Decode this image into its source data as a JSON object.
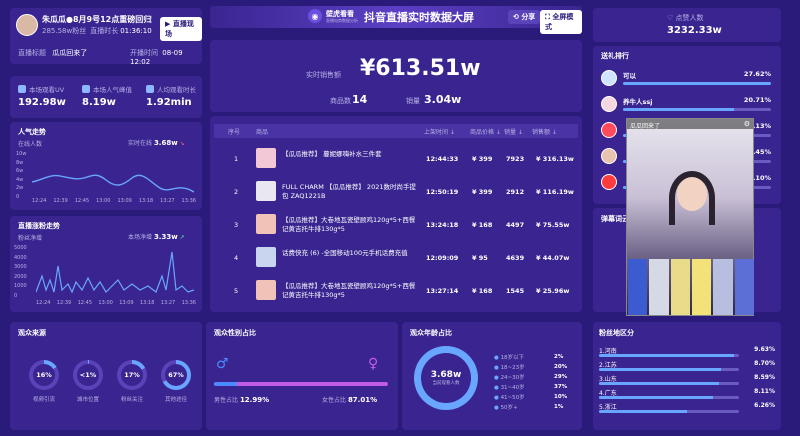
{
  "header": {
    "streamer_name": "朱瓜瓜●8月9号12点重磅回归宋...",
    "fans": "285.58w粉丝",
    "live_duration_label": "直播时长",
    "live_duration": "01:36:10",
    "live_button": "直播现场",
    "live_title_label": "直播标题",
    "live_title": "瓜瓜回来了",
    "start_label": "开播时间",
    "start_time": "08-09 12:02",
    "brand_name": "壁虎看看",
    "brand_sub": "直播电商数据分析",
    "screen_title": "抖音直播实时数据大屏",
    "share_button": "分享",
    "fullscreen_button": "全屏模式",
    "likes_label": "点赞人数",
    "likes_value": "3232.33w"
  },
  "metrics": [
    {
      "label": "本场观看UV",
      "value": "192.98w",
      "icon": "eye-icon"
    },
    {
      "label": "本场人气峰值",
      "value": "8.19w",
      "icon": "fire-icon"
    },
    {
      "label": "人均观看时长",
      "value": "1.92min",
      "icon": "clock-icon"
    }
  ],
  "popularity": {
    "title": "人气走势",
    "sub_label": "在线人数",
    "rt_label": "实时在线",
    "rt_value": "3.68w",
    "y_ticks": [
      "10w",
      "8w",
      "6w",
      "4w",
      "2w",
      "0"
    ],
    "x_ticks": [
      "12:24",
      "12:39",
      "12:45",
      "13:00",
      "13:09",
      "13:18",
      "13:27",
      "13:36"
    ]
  },
  "fans_trend": {
    "title": "直播涨粉走势",
    "sub_label": "粉丝净增",
    "rt_label": "本场净增",
    "rt_value": "3.33w",
    "y_ticks": [
      "5000",
      "4000",
      "3000",
      "2000",
      "1000",
      "0"
    ],
    "x_ticks": [
      "12:24",
      "12:39",
      "12:45",
      "13:00",
      "13:09",
      "13:18",
      "13:27",
      "13:36"
    ]
  },
  "sales": {
    "label": "实时销售额",
    "value": "¥613.51w",
    "count_label": "商品数",
    "count": "14",
    "volume_label": "销量",
    "volume": "3.04w"
  },
  "products": {
    "headers": [
      "序号",
      "商品",
      "上架时间 ↓",
      "商品价格 ↓",
      "销量 ↓",
      "销售额 ↓"
    ],
    "rows": [
      {
        "idx": "1",
        "name": "【瓜瓜推荐】 蔓妮娜嗨补水三件套",
        "time": "12:44:33",
        "price": "¥ 399",
        "sold": "7923",
        "revenue": "¥ 316.13w"
      },
      {
        "idx": "2",
        "name": "FULL CHARM 【瓜瓜推荐】 2021数时尚手提包 ZAQ1221B",
        "time": "12:50:19",
        "price": "¥ 399",
        "sold": "2912",
        "revenue": "¥ 116.19w"
      },
      {
        "idx": "3",
        "name": "【瓜瓜推荐】大卷地瓦瓷壁顾鸡120g*5+西餐记黄吉托牛排130g*5",
        "time": "13:24:18",
        "price": "¥ 168",
        "sold": "4497",
        "revenue": "¥ 75.55w"
      },
      {
        "idx": "4",
        "name": "话费快充 (6) -全国移动100元手机话费充值",
        "time": "12:09:09",
        "price": "¥ 95",
        "sold": "4639",
        "revenue": "¥ 44.07w"
      },
      {
        "idx": "5",
        "name": "【瓜瓜推荐】大卷地瓦瓷壁顾鸡120g*5+西餐记黄吉托牛排130g*5",
        "time": "13:27:14",
        "price": "¥ 168",
        "sold": "1545",
        "revenue": "¥ 25.96w"
      }
    ]
  },
  "gift_rank": {
    "title": "送礼排行",
    "items": [
      {
        "name": "可以",
        "pct": "27.62%",
        "fill": 0.2762
      },
      {
        "name": "养牛人ssj",
        "pct": "20.71%",
        "fill": 0.2071
      },
      {
        "name": "",
        "pct": "4.13%",
        "fill": 0.0413
      },
      {
        "name": "",
        "pct": "3.45%",
        "fill": 0.0345
      },
      {
        "name": "",
        "pct": "3.10%",
        "fill": 0.031
      }
    ]
  },
  "video": {
    "label": "瓜瓜回来了"
  },
  "danmaku": {
    "title": "弹幕词云"
  },
  "audience_source": {
    "title": "观众来源",
    "items": [
      {
        "label": "视频引流",
        "value": "16%",
        "pct": 16
      },
      {
        "label": "城市位置",
        "value": "<1%",
        "pct": 1
      },
      {
        "label": "粉丝关注",
        "value": "17%",
        "pct": 17
      },
      {
        "label": "其他途径",
        "value": "67%",
        "pct": 67
      }
    ]
  },
  "gender": {
    "title": "观众性别占比",
    "male_label": "男性占比",
    "male_value": "12.99%",
    "male_fill": 0.1299,
    "female_label": "女性占比",
    "female_value": "87.01%"
  },
  "age": {
    "title": "观众年龄占比",
    "center_value": "3.68w",
    "center_label": "当前观看人数",
    "items": [
      {
        "label": "18岁以下",
        "pct": "2%"
      },
      {
        "label": "18~23岁",
        "pct": "20%"
      },
      {
        "label": "24~30岁",
        "pct": "29%"
      },
      {
        "label": "31~40岁",
        "pct": "37%"
      },
      {
        "label": "41~50岁",
        "pct": "10%"
      },
      {
        "label": "50岁+",
        "pct": "1%"
      }
    ]
  },
  "region": {
    "title": "粉丝地区分",
    "items": [
      {
        "label": "1.河南",
        "pct": "9.63%",
        "fill": 0.963
      },
      {
        "label": "2.江苏",
        "pct": "8.70%",
        "fill": 0.87
      },
      {
        "label": "3.山东",
        "pct": "8.59%",
        "fill": 0.859
      },
      {
        "label": "4.广东",
        "pct": "8.11%",
        "fill": 0.811
      },
      {
        "label": "5.浙江",
        "pct": "6.26%",
        "fill": 0.626
      }
    ]
  },
  "colors": {
    "background": "#2a1a7a",
    "panel": "#3a2590",
    "accent_blue": "#69a6ff",
    "accent_pink": "#c05be8"
  }
}
